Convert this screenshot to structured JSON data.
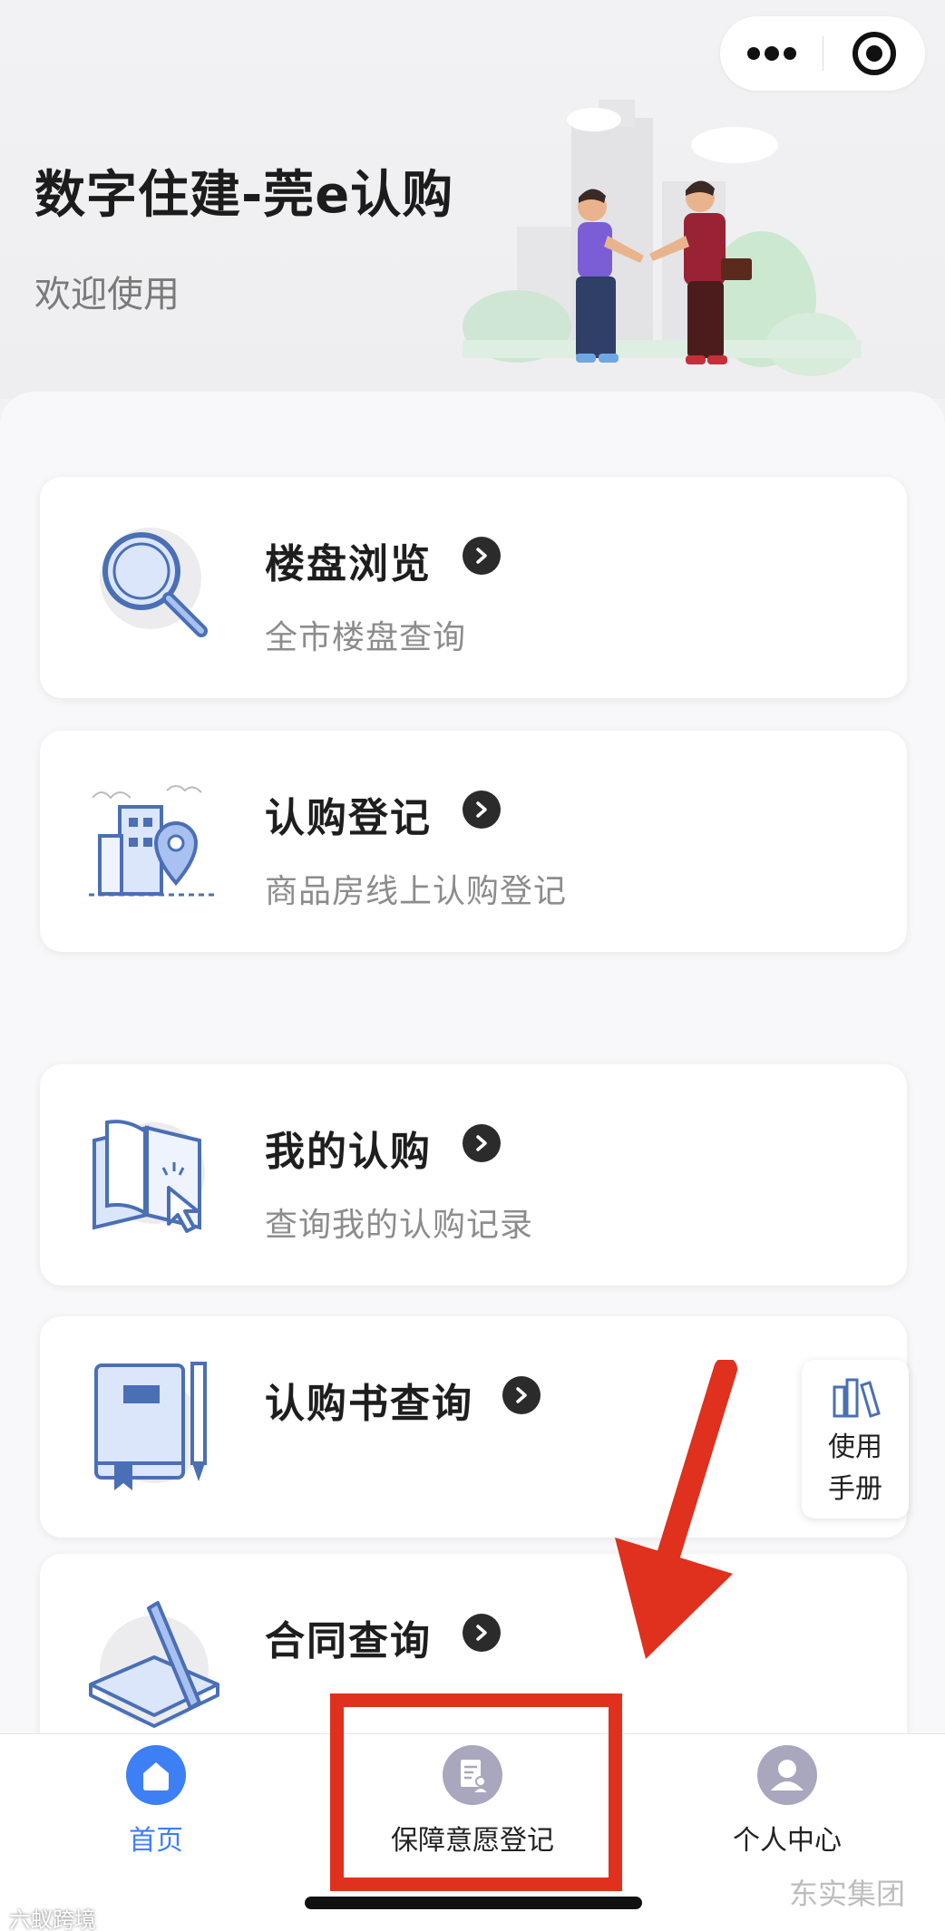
{
  "header": {
    "title": "数字住建-莞e认购",
    "subtitle": "欢迎使用"
  },
  "capsule": {
    "more_icon": "more-dots-icon",
    "close_icon": "target-circle-icon"
  },
  "cards": [
    {
      "title": "楼盘浏览",
      "subtitle": "全市楼盘查询",
      "icon": "magnifier-icon"
    },
    {
      "title": "认购登记",
      "subtitle": "商品房线上认购登记",
      "icon": "building-location-icon"
    },
    {
      "title": "我的认购",
      "subtitle": "查询我的认购记录",
      "icon": "open-book-cursor-icon"
    },
    {
      "title": "认购书查询",
      "subtitle": "",
      "icon": "notebook-pencil-icon"
    },
    {
      "title": "合同查询",
      "subtitle": "",
      "icon": "contract-pen-icon"
    }
  ],
  "manual": {
    "line1": "使用",
    "line2": "手册",
    "icon": "books-icon"
  },
  "tabbar": {
    "items": [
      {
        "label": "首页",
        "icon": "home-icon",
        "active": true
      },
      {
        "label": "保障意愿登记",
        "icon": "document-user-icon",
        "active": false
      },
      {
        "label": "个人中心",
        "icon": "user-icon",
        "active": false
      }
    ]
  },
  "watermarks": {
    "left": "六蚁跨境",
    "right": "东实集团"
  },
  "colors": {
    "accent": "#3d7ff5",
    "annotation_red": "#e0301e",
    "icon_blue": "#4a6fb5"
  }
}
